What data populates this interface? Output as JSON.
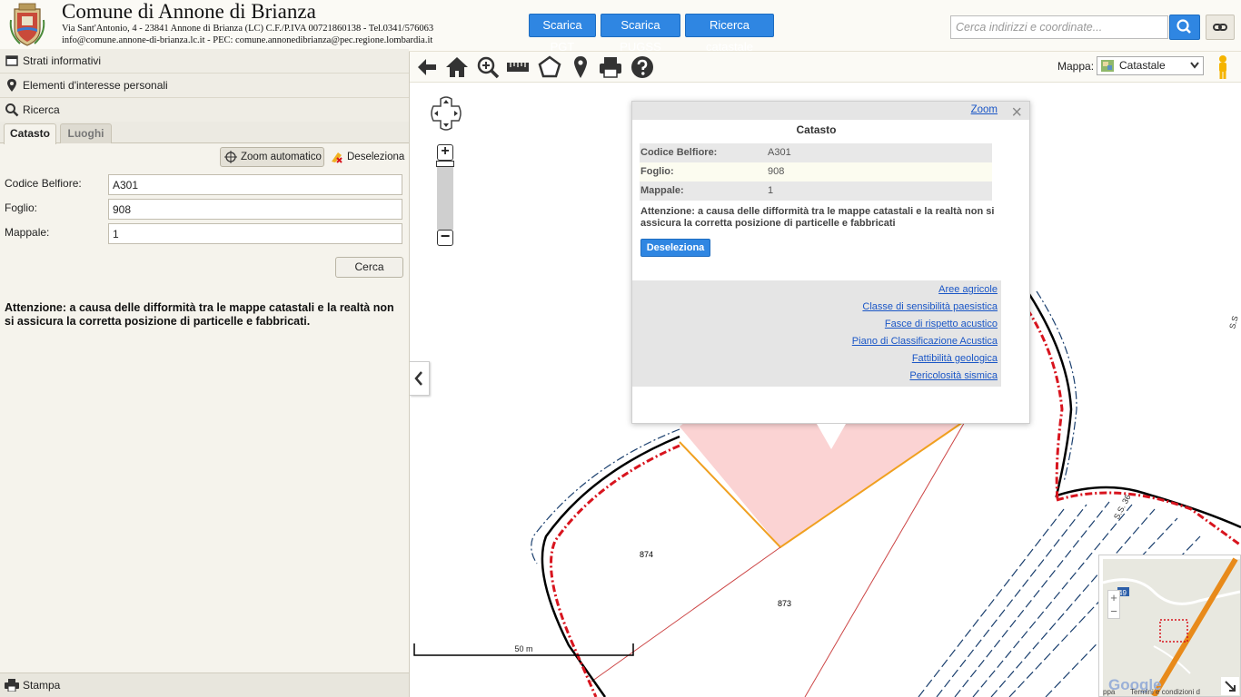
{
  "header": {
    "title": "Comune di Annone di Brianza",
    "address_line1": "Via Sant'Antonio, 4 - 23841 Annone di Brianza (LC) C.F./P.IVA 00721860138 - Tel.0341/576063",
    "address_line2": "info@comune.annone-di-brianza.lc.it - PEC: comune.annonedibrianza@pec.regione.lombardia.it",
    "buttons": [
      "Scarica PGT",
      "Scarica PUGSS",
      "Ricerca catastale"
    ],
    "search_placeholder": "Cerca indirizzi e coordinate..."
  },
  "sidebar": {
    "menu": [
      "Strati informativi",
      "Elementi d'interesse personali",
      "Ricerca"
    ],
    "tabs": [
      "Catasto",
      "Luoghi"
    ],
    "zoom_auto": "Zoom automatico",
    "deseleziona": "Deseleziona",
    "form": {
      "belfiore_label": "Codice Belfiore:",
      "belfiore_value": "A301",
      "foglio_label": "Foglio:",
      "foglio_value": "908",
      "mappale_label": "Mappale:",
      "mappale_value": "1"
    },
    "cerca": "Cerca",
    "warning": "Attenzione: a causa delle difformità tra le mappe catastali e la realtà non si assicura la corretta posizione di particelle e fabbricati.",
    "stampa": "Stampa"
  },
  "toolbar": {
    "map_label": "Mappa:",
    "map_select": "Catastale"
  },
  "map": {
    "scale_label": "50 m",
    "parcel_labels": [
      "874",
      "873"
    ],
    "road_label": "S.S. 36",
    "road_label_2": "S.S",
    "overview_badge": "49",
    "overview_footer": "Termini e condizioni d",
    "overview_prefix": "ppa",
    "google": "Google"
  },
  "popup": {
    "zoom": "Zoom",
    "close": "×",
    "title": "Catasto",
    "rows": [
      {
        "key": "Codice Belfiore:",
        "value": "A301"
      },
      {
        "key": "Foglio:",
        "value": "908"
      },
      {
        "key": "Mappale:",
        "value": "1"
      }
    ],
    "warning": "Attenzione: a causa delle difformità tra le mappe catastali e la realtà non si assicura la corretta posizione di particelle e fabbricati",
    "deseleziona": "Deseleziona",
    "links": [
      "Aree agricole",
      "Classe di sensibilità paesistica",
      "Fasce di rispetto acustico",
      "Piano di Classificazione Acustica",
      "Fattibilità geologica",
      "Pericolosità sismica"
    ]
  },
  "colors": {
    "accent": "#2f86e2",
    "parcel_fill": "#fbd3d3",
    "parcel_border": "#f0a020",
    "boundary_red": "#d8141e",
    "road_blue": "#1a3f6e"
  }
}
